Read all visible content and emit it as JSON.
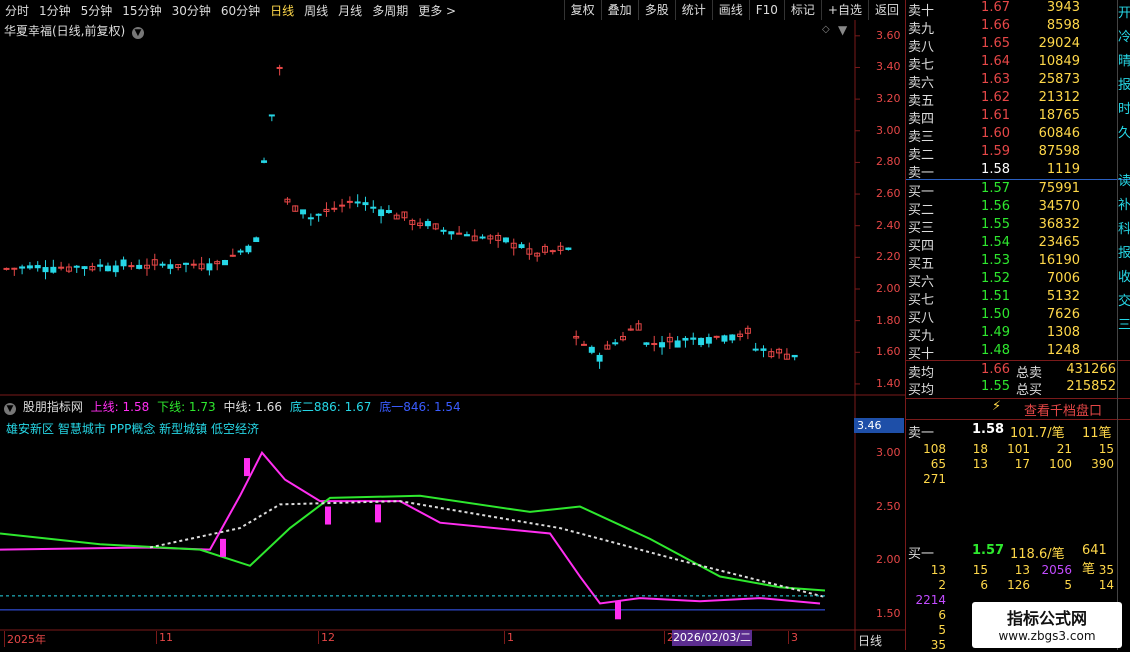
{
  "toolbar": {
    "periods": [
      "分时",
      "1分钟",
      "5分钟",
      "15分钟",
      "30分钟",
      "60分钟",
      "日线",
      "周线",
      "月线",
      "多周期",
      "更多 >"
    ],
    "active": "日线",
    "tools": [
      "复权",
      "叠加",
      "多股",
      "统计",
      "画线",
      "F10",
      "标记",
      "+自选",
      "返回"
    ]
  },
  "stock": {
    "title": "华夏幸福(日线,前复权)"
  },
  "price_axis": [
    "3.60",
    "3.40",
    "3.20",
    "3.00",
    "2.80",
    "2.60",
    "2.40",
    "2.20",
    "2.00",
    "1.80",
    "1.60",
    "1.40"
  ],
  "indicator": {
    "name": "股朋指标网",
    "up_label": "上线: 1.58",
    "down_label": "下线: 1.73",
    "mid_label": "中线: 1.66",
    "bottom2_label": "底二886: 1.67",
    "bottom1_label": "底一846: 1.54",
    "concepts": "雄安新区 智慧城市 PPP概念 新型城镇 低空经济",
    "axis": [
      "3.00",
      "2.50",
      "2.00",
      "1.50"
    ],
    "flag": "3.46"
  },
  "date_axis": {
    "labels": [
      "2025年",
      "11",
      "12",
      "1",
      "2",
      "3"
    ],
    "selected": "2026/02/03/二",
    "period": "日线"
  },
  "orderbook": {
    "sell": [
      {
        "label": "卖十",
        "price": "1.67",
        "vol": "3943"
      },
      {
        "label": "卖九",
        "price": "1.66",
        "vol": "8598"
      },
      {
        "label": "卖八",
        "price": "1.65",
        "vol": "29024"
      },
      {
        "label": "卖七",
        "price": "1.64",
        "vol": "10849"
      },
      {
        "label": "卖六",
        "price": "1.63",
        "vol": "25873"
      },
      {
        "label": "卖五",
        "price": "1.62",
        "vol": "21312"
      },
      {
        "label": "卖四",
        "price": "1.61",
        "vol": "18765"
      },
      {
        "label": "卖三",
        "price": "1.60",
        "vol": "60846"
      },
      {
        "label": "卖二",
        "price": "1.59",
        "vol": "87598"
      },
      {
        "label": "卖一",
        "price": "1.58",
        "vol": "1119"
      }
    ],
    "buy": [
      {
        "label": "买一",
        "price": "1.57",
        "vol": "75991"
      },
      {
        "label": "买二",
        "price": "1.56",
        "vol": "34570"
      },
      {
        "label": "买三",
        "price": "1.55",
        "vol": "36832"
      },
      {
        "label": "买四",
        "price": "1.54",
        "vol": "23465"
      },
      {
        "label": "买五",
        "price": "1.53",
        "vol": "16190"
      },
      {
        "label": "买六",
        "price": "1.52",
        "vol": "7006"
      },
      {
        "label": "买七",
        "price": "1.51",
        "vol": "5132"
      },
      {
        "label": "买八",
        "price": "1.50",
        "vol": "7626"
      },
      {
        "label": "买九",
        "price": "1.49",
        "vol": "1308"
      },
      {
        "label": "买十",
        "price": "1.48",
        "vol": "1248"
      }
    ],
    "sell_avg": {
      "label": "卖均",
      "price": "1.66",
      "tl": "总卖",
      "tv": "431266"
    },
    "buy_avg": {
      "label": "买均",
      "price": "1.55",
      "tl": "总买",
      "tv": "215852"
    }
  },
  "thousand_button": "查看千档盘口",
  "queue": {
    "sell_head": {
      "label": "卖一",
      "price": "1.58",
      "avg": "101.7/笔",
      "count": "11笔"
    },
    "sell_rows": [
      [
        "108",
        "18",
        "101",
        "21",
        "15"
      ],
      [
        "65",
        "13",
        "17",
        "100",
        "390"
      ],
      [
        "271",
        "",
        "",
        "",
        ""
      ]
    ],
    "buy_head": {
      "label": "买一",
      "price": "1.57",
      "avg": "118.6/笔",
      "count": "641笔"
    },
    "buy_rows": [
      [
        "13",
        "15",
        "13",
        "2056",
        "35"
      ],
      [
        "2",
        "6",
        "126",
        "5",
        "14"
      ],
      [
        "2214",
        "",
        "",
        "",
        ""
      ],
      [
        "6",
        "",
        "",
        "",
        ""
      ],
      [
        "5",
        "",
        "",
        "",
        ""
      ],
      [
        "35",
        "",
        "",
        "",
        ""
      ]
    ]
  },
  "side_stripe": [
    "开",
    "冷",
    "晴",
    "报",
    "时",
    "久",
    "",
    "读",
    "补",
    "科",
    "报",
    "收",
    "交",
    "三"
  ],
  "watermark": {
    "title": "指标公式网",
    "url": "www.zbgs3.com"
  },
  "colors": {
    "up": "#e64747",
    "down": "#26d7e6",
    "green": "#2ee82e",
    "magenta": "#ff2ef0",
    "yellow": "#ffd84a"
  }
}
